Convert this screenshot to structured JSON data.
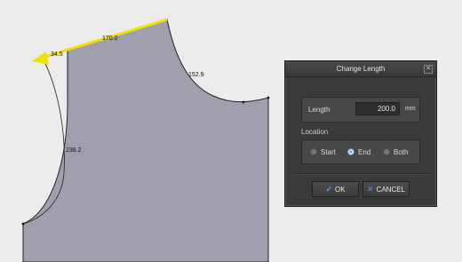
{
  "canvas": {
    "dimensions": {
      "top": "170.0",
      "arrow_end": "34.5",
      "neck": "152.9",
      "side": "238.2"
    },
    "colors": {
      "piece_fill": "#a09fb0",
      "highlight": "#f2e000",
      "arrow": "#f2e000",
      "outline": "#222222"
    }
  },
  "dialog": {
    "title": "Change Length",
    "close_icon": "close-icon",
    "length_label": "Length",
    "length_value": "200.0",
    "unit": "mm",
    "location_label": "Location",
    "options": {
      "start": "Start",
      "end": "End",
      "both": "Both"
    },
    "selected_option": "End",
    "ok_label": "OK",
    "cancel_label": "CANCEL",
    "ok_icon": "check-icon",
    "cancel_icon": "x-icon"
  }
}
